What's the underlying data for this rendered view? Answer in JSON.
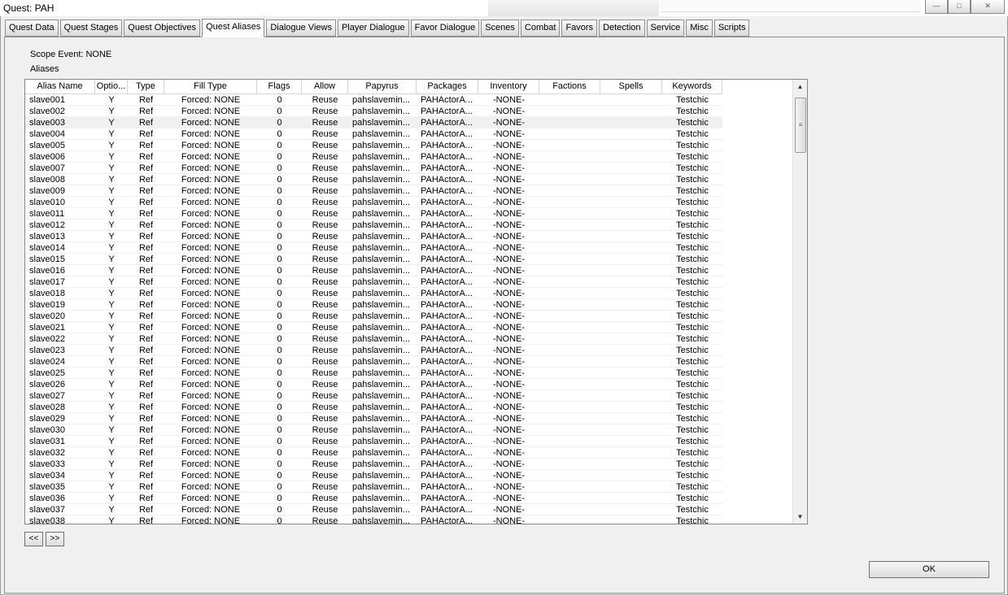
{
  "window": {
    "title": "Quest: PAH",
    "min": "—",
    "max": "□",
    "close": "✕"
  },
  "tabs": [
    "Quest Data",
    "Quest Stages",
    "Quest Objectives",
    "Quest Aliases",
    "Dialogue Views",
    "Player Dialogue",
    "Favor Dialogue",
    "Scenes",
    "Combat",
    "Favors",
    "Detection",
    "Service",
    "Misc",
    "Scripts"
  ],
  "active_tab": "Quest Aliases",
  "scope_event": "Scope Event: NONE",
  "aliases_label": "Aliases",
  "columns": [
    "Alias Name",
    "Optio...",
    "Type",
    "Fill Type",
    "Flags",
    "Allow",
    "Papyrus",
    "Packages",
    "Inventory",
    "Factions",
    "Spells",
    "Keywords"
  ],
  "row_defaults": {
    "optional": "Y",
    "type": "Ref",
    "fill_type": "Forced: NONE",
    "flags": "0",
    "allow": "Reuse",
    "papyrus": "pahslavemin...",
    "packages": "PAHActorA...",
    "inventory": "-NONE-",
    "factions": "",
    "spells": "",
    "keywords": "Testchic"
  },
  "rows": [
    "slave001",
    "slave002",
    "slave003",
    "slave004",
    "slave005",
    "slave006",
    "slave007",
    "slave008",
    "slave009",
    "slave010",
    "slave011",
    "slave012",
    "slave013",
    "slave014",
    "slave015",
    "slave016",
    "slave017",
    "slave018",
    "slave019",
    "slave020",
    "slave021",
    "slave022",
    "slave023",
    "slave024",
    "slave025",
    "slave026",
    "slave027",
    "slave028",
    "slave029",
    "slave030",
    "slave031",
    "slave032",
    "slave033",
    "slave034",
    "slave035",
    "slave036",
    "slave037",
    "slave038"
  ],
  "highlighted_row": "slave003",
  "nav": {
    "prev": "<<",
    "next": ">>"
  },
  "ok_label": "OK",
  "scroll": {
    "up": "▲",
    "down": "▼",
    "grip": "≡"
  }
}
